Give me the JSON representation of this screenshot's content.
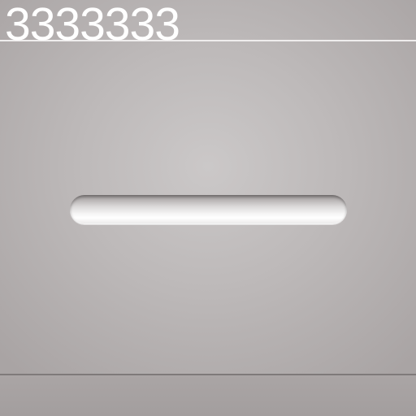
{
  "display": {
    "value": "3333333"
  },
  "colors": {
    "display_text": "#ffffff",
    "background": "#c4c1c1",
    "slot_highlight": "#ffffff"
  }
}
